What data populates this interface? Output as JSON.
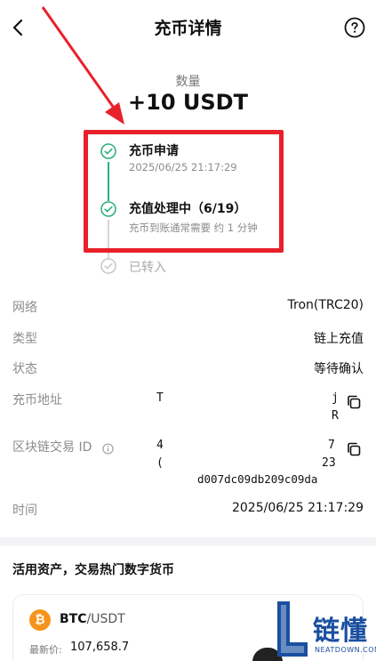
{
  "header": {
    "title": "充币详情"
  },
  "amount": {
    "label": "数量",
    "value": "+10 USDT"
  },
  "timeline": [
    {
      "title": "充币申请",
      "sub": "2025/06/25 21:17:29",
      "state": "done"
    },
    {
      "title": "充值处理中（6/19）",
      "sub": "充币到账通常需要 约 1 分钟",
      "state": "current"
    },
    {
      "title": "已转入",
      "sub": "",
      "state": "pending"
    }
  ],
  "details": {
    "network": {
      "label": "网络",
      "value": "Tron(TRC20)"
    },
    "type": {
      "label": "类型",
      "value": "链上充值"
    },
    "status": {
      "label": "状态",
      "value": "等待确认"
    },
    "address": {
      "label": "充币地址",
      "frag_start": "T",
      "frag_end_1": "j",
      "frag_end_2": "R"
    },
    "txid": {
      "label": "区块链交易 ID",
      "frag_start_1": "4",
      "frag_start_2": "(",
      "frag_end_1": "7",
      "frag_end_2": "23",
      "frag_tail": "d007dc09db209c09da"
    },
    "time": {
      "label": "时间",
      "value": "2025/06/25 21:17:29"
    }
  },
  "promo": {
    "title": "活用资产，交易热门数字货币",
    "card": {
      "base": "BTC",
      "quote": "/USDT",
      "price_label": "最新价:",
      "price": "107,658.7"
    }
  },
  "watermark": {
    "text": "链懂",
    "url": "NEATDOWN.COM"
  },
  "colors": {
    "accent_green": "#2fb07a",
    "highlight_red": "#e8202a",
    "watermark_blue": "#1a4fa0",
    "btc_orange": "#f7931a"
  },
  "icons": [
    "back-arrow-icon",
    "help-circle-icon",
    "check-circle-icon",
    "info-icon",
    "copy-icon",
    "bitcoin-icon"
  ]
}
